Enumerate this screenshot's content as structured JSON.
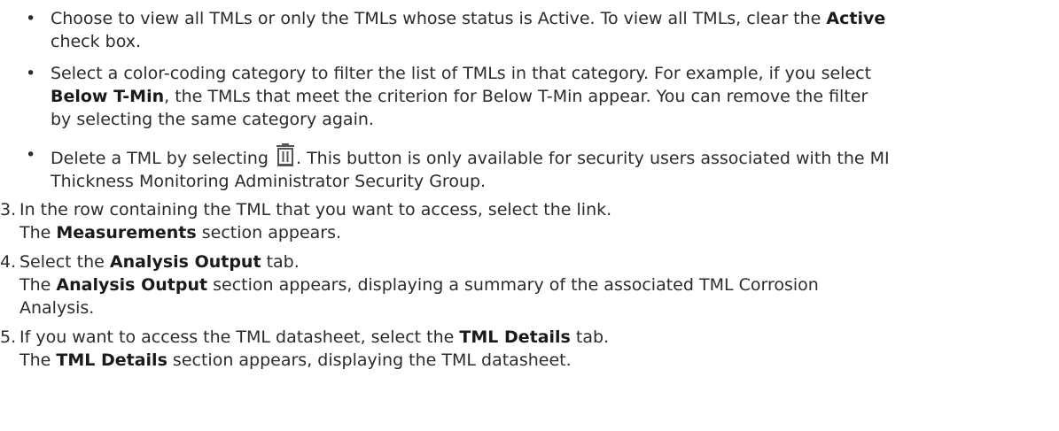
{
  "bullets": [
    {
      "marker": "•",
      "text1": "Choose to view all TMLs or only the TMLs whose status is Active. To view all TMLs, clear the ",
      "bold1": "Active",
      "text2": "check box."
    },
    {
      "marker": "•",
      "text1": "Select a color-coding category to filter the list of TMLs in that category. For example, if you select",
      "bold1": "Below T-Min",
      "text2": ", the TMLs that meet the criterion for Below T-Min appear. You can remove the filter",
      "text3": "by selecting the same category again."
    },
    {
      "marker": "•",
      "text1": "Delete a TML by selecting ",
      "icon": "trash-icon",
      "text2": ". This button is only available for security users associated with the MI",
      "text3": "Thickness Monitoring Administrator Security Group."
    }
  ],
  "steps": [
    {
      "number": "3.",
      "text1": "In the row containing the TML that you want to access, select the link.",
      "text2a": "The ",
      "bold": "Measurements",
      "text2b": " section appears."
    },
    {
      "number": "4.",
      "text1a": "Select the ",
      "bold1": "Analysis Output",
      "text1b": " tab.",
      "text2a": "The ",
      "bold2": "Analysis Output",
      "text2b": " section appears, displaying a summary of the associated TML Corrosion",
      "text3": "Analysis."
    },
    {
      "number": "5.",
      "text1a": "If you want to access the TML datasheet, select the ",
      "bold1": "TML Details",
      "text1b": " tab.",
      "text2a": "The ",
      "bold2": "TML Details",
      "text2b": " section appears, displaying the TML datasheet."
    }
  ]
}
